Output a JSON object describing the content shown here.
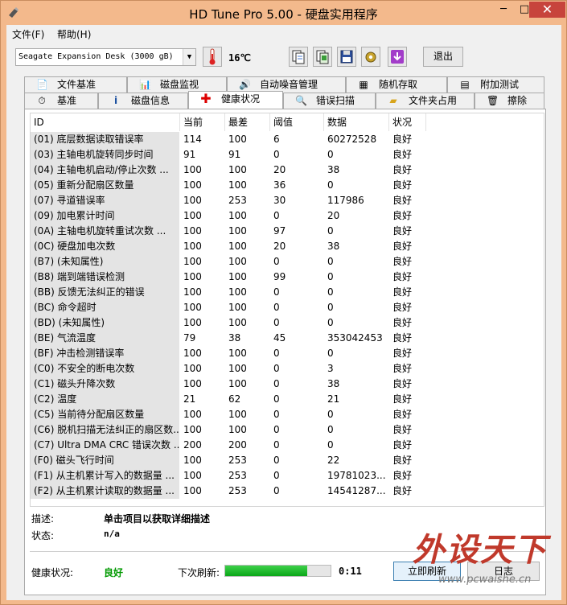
{
  "window": {
    "title": "HD Tune Pro 5.00 - 硬盘实用程序",
    "min": "─",
    "max": "□",
    "close": "✕"
  },
  "menu": {
    "file": "文件(F)",
    "help": "帮助(H)"
  },
  "toolbar": {
    "drive": "Seagate Expansion Desk    (3000 gB)",
    "temperature": "16℃",
    "exit_label": "退出"
  },
  "tabs_row1": [
    {
      "label": "文件基准",
      "icon": "file-benchmark-icon"
    },
    {
      "label": "磁盘监视",
      "icon": "disk-monitor-icon"
    },
    {
      "label": "自动噪音管理",
      "icon": "speaker-icon"
    },
    {
      "label": "随机存取",
      "icon": "random-access-icon"
    },
    {
      "label": "附加测试",
      "icon": "extra-tests-icon"
    }
  ],
  "tabs_row2": [
    {
      "label": "基准",
      "icon": "benchmark-icon"
    },
    {
      "label": "磁盘信息",
      "icon": "info-icon"
    },
    {
      "label": "健康状况",
      "icon": "health-cross-icon"
    },
    {
      "label": "错误扫描",
      "icon": "magnifier-icon"
    },
    {
      "label": "文件夹占用",
      "icon": "folder-icon"
    },
    {
      "label": "擦除",
      "icon": "trash-icon"
    }
  ],
  "table": {
    "headers": [
      "ID",
      "当前",
      "最差",
      "阈值",
      "数据",
      "状况"
    ],
    "rows": [
      [
        "(01) 底层数据读取错误率",
        "114",
        "100",
        "6",
        "60272528",
        "良好"
      ],
      [
        "(03) 主轴电机旋转同步时间",
        "91",
        "91",
        "0",
        "0",
        "良好"
      ],
      [
        "(04) 主轴电机启动/停止次数 ...",
        "100",
        "100",
        "20",
        "38",
        "良好"
      ],
      [
        "(05) 重新分配扇区数量",
        "100",
        "100",
        "36",
        "0",
        "良好"
      ],
      [
        "(07) 寻道错误率",
        "100",
        "253",
        "30",
        "117986",
        "良好"
      ],
      [
        "(09) 加电累计时间",
        "100",
        "100",
        "0",
        "20",
        "良好"
      ],
      [
        "(0A) 主轴电机旋转重试次数 ...",
        "100",
        "100",
        "97",
        "0",
        "良好"
      ],
      [
        "(0C) 硬盘加电次数",
        "100",
        "100",
        "20",
        "38",
        "良好"
      ],
      [
        "(B7) (未知属性)",
        "100",
        "100",
        "0",
        "0",
        "良好"
      ],
      [
        "(B8) 端到端错误检测",
        "100",
        "100",
        "99",
        "0",
        "良好"
      ],
      [
        "(BB) 反馈无法纠正的错误",
        "100",
        "100",
        "0",
        "0",
        "良好"
      ],
      [
        "(BC) 命令超时",
        "100",
        "100",
        "0",
        "0",
        "良好"
      ],
      [
        "(BD) (未知属性)",
        "100",
        "100",
        "0",
        "0",
        "良好"
      ],
      [
        "(BE) 气流温度",
        "79",
        "38",
        "45",
        "353042453",
        "良好"
      ],
      [
        "(BF) 冲击检测错误率",
        "100",
        "100",
        "0",
        "0",
        "良好"
      ],
      [
        "(C0) 不安全的断电次数",
        "100",
        "100",
        "0",
        "3",
        "良好"
      ],
      [
        "(C1) 磁头升降次数",
        "100",
        "100",
        "0",
        "38",
        "良好"
      ],
      [
        "(C2) 温度",
        "21",
        "62",
        "0",
        "21",
        "良好"
      ],
      [
        "(C5) 当前待分配扇区数量",
        "100",
        "100",
        "0",
        "0",
        "良好"
      ],
      [
        "(C6) 脱机扫描无法纠正的扇区数...",
        "100",
        "100",
        "0",
        "0",
        "良好"
      ],
      [
        "(C7) Ultra DMA CRC 错误次数 ...",
        "200",
        "200",
        "0",
        "0",
        "良好"
      ],
      [
        "(F0) 磁头飞行时间",
        "100",
        "253",
        "0",
        "22",
        "良好"
      ],
      [
        "(F1) 从主机累计写入的数据量 ...",
        "100",
        "253",
        "0",
        "19781023...",
        "良好"
      ],
      [
        "(F2) 从主机累计读取的数据量 ...",
        "100",
        "253",
        "0",
        "14541287...",
        "良好"
      ]
    ]
  },
  "details": {
    "desc_label": "描述:",
    "desc_value": "单击项目以获取详细描述",
    "state_label": "状态:",
    "state_value": "n/a"
  },
  "footer": {
    "health_label": "健康状况:",
    "health_value": "良好",
    "refresh_label": "下次刷新:",
    "progress": 0.78,
    "countdown": "0:11",
    "refresh_btn": "立即刷新",
    "log_btn": "日志"
  },
  "watermark": {
    "text": "外设天下",
    "url": "www.pcwaishe.cn"
  },
  "colors": {
    "health_good": "#009900",
    "frame": "#f3b98c",
    "close": "#c7443c"
  }
}
